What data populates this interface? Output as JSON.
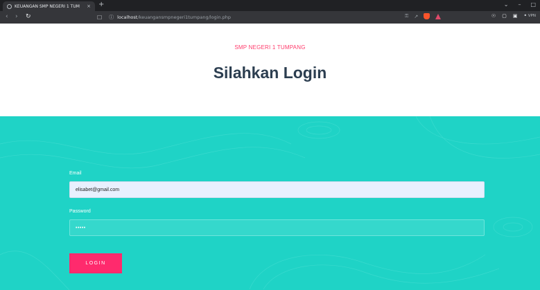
{
  "browser": {
    "tab_title": "KEUANGAN SMP NEGERI 1 TUM",
    "tab_close": "×",
    "new_tab": "+",
    "url_host": "localhost",
    "url_path": "/keuangansmpnegeri1tumpang/login.php",
    "vpn_label": "VPN"
  },
  "page": {
    "school_name": "SMP NEGERI 1 TUMPANG",
    "heading": "Silahkan Login"
  },
  "form": {
    "email_label": "Email",
    "email_value": "elisabet@gmail.com",
    "password_label": "Password",
    "password_value": "•••••",
    "login_button": "LOGIN"
  },
  "colors": {
    "accent": "#ff2a6d",
    "panel_bg": "#1fd3c6",
    "heading": "#2c3e50"
  }
}
